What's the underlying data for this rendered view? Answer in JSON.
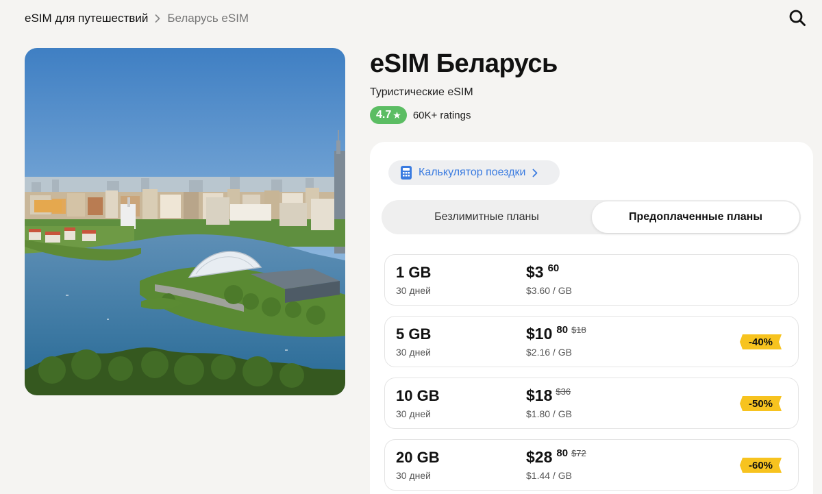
{
  "breadcrumb": {
    "items": [
      "eSIM для путешествий",
      "Беларусь eSIM"
    ]
  },
  "icons": {
    "search": "search-icon",
    "chevron": "chevron-right-icon",
    "calculator": "calculator-icon",
    "star": "star-icon"
  },
  "colors": {
    "background": "#f5f4f2",
    "rating_green": "#5bbd63",
    "accent_blue": "#3a7be0",
    "discount_yellow": "#f7c31f"
  },
  "hero": {
    "image": "city-skyline-photo"
  },
  "product": {
    "title": "eSIM Беларусь",
    "subtitle": "Туристические eSIM",
    "rating": "4.7",
    "rating_star": "★",
    "rating_count": "60K+ ratings"
  },
  "calculator": {
    "label": "Калькулятор поездки"
  },
  "tabs": [
    {
      "label": "Безлимитные планы",
      "active": false
    },
    {
      "label": "Предоплаченные планы",
      "active": true
    }
  ],
  "plans": [
    {
      "size": "1 GB",
      "days": "30 дней",
      "price": "$3",
      "cents": "60",
      "old_price": "",
      "per_gb": "$3.60 / GB",
      "discount": ""
    },
    {
      "size": "5 GB",
      "days": "30 дней",
      "price": "$10",
      "cents": "80",
      "old_price": "$18",
      "per_gb": "$2.16 / GB",
      "discount": "-40%"
    },
    {
      "size": "10 GB",
      "days": "30 дней",
      "price": "$18",
      "cents": "",
      "old_price": "$36",
      "per_gb": "$1.80 / GB",
      "discount": "-50%"
    },
    {
      "size": "20 GB",
      "days": "30 дней",
      "price": "$28",
      "cents": "80",
      "old_price": "$72",
      "per_gb": "$1.44 / GB",
      "discount": "-60%"
    }
  ]
}
